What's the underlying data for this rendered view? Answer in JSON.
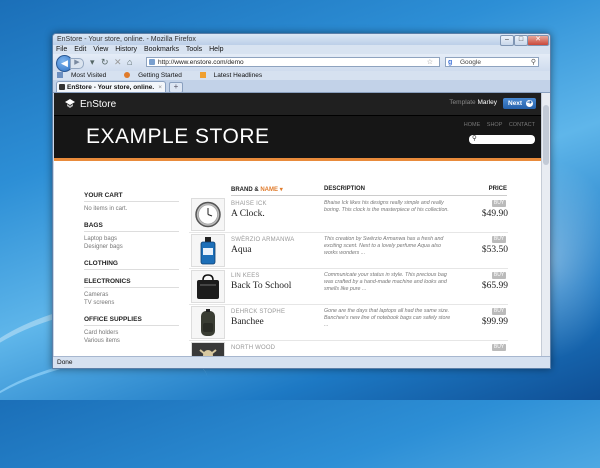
{
  "browser": {
    "title": "EnStore - Your store, online. - Mozilla Firefox",
    "menu": [
      "File",
      "Edit",
      "View",
      "History",
      "Bookmarks",
      "Tools",
      "Help"
    ],
    "url": "http://www.enstore.com/demo",
    "search_engine": "Google",
    "bookmarks": [
      "Most Visited",
      "Getting Started",
      "Latest Headlines"
    ],
    "tab_title": "EnStore - Your store, online.",
    "status": "Done"
  },
  "store": {
    "logo": "EnStore",
    "template_label": "Template",
    "template_name": "Marley",
    "next_label": "Next",
    "hero_title": "EXAMPLE STORE",
    "nav": [
      "HOME",
      "SHOP",
      "CONTACT"
    ]
  },
  "sidebar": {
    "cart_title": "YOUR CART",
    "cart_empty": "No items in cart.",
    "sections": [
      {
        "title": "BAGS",
        "items": [
          "Laptop bags",
          "Designer bags"
        ]
      },
      {
        "title": "CLOTHING",
        "items": []
      },
      {
        "title": "ELECTRONICS",
        "items": [
          "Cameras",
          "TV screens"
        ]
      },
      {
        "title": "OFFICE SUPPLIES",
        "items": [
          "Card holders",
          "Various items"
        ]
      }
    ]
  },
  "products_header": {
    "brand": "BRAND &",
    "name": "NAME",
    "description": "DESCRIPTION",
    "price": "PRICE"
  },
  "buy_label": "BUY",
  "products": [
    {
      "brand": "BHAISE ICK",
      "name": "A Clock.",
      "desc": "Bhaise Ick likes his designs really simple and really boring. This clock is the masterpiece of his collection.",
      "price": "$49.90",
      "icon": "clock-icon"
    },
    {
      "brand": "SWËRZIO ARMANWA",
      "name": "Aqua",
      "desc": "This creation by Swërzio Armanwa has a fresh and exciting scent. Next to a lovely perfume Aqua also works wonders ...",
      "price": "$53.50",
      "icon": "perfume-icon"
    },
    {
      "brand": "LIN KEES",
      "name": "Back To School",
      "desc": "Communicate your status in style. This precious bag was crafted by a hand-made machine and looks and smells like pure ...",
      "price": "$65.99",
      "icon": "bag-icon"
    },
    {
      "brand": "DEHRCK STOPHE",
      "name": "Banchee",
      "desc": "Gone are the days that laptops all had the same size. Banchee's new line of notebook bags can safely store ...",
      "price": "$99.99",
      "icon": "backpack-icon"
    },
    {
      "brand": "NORTH WOOD",
      "name": "",
      "desc": "",
      "price": "",
      "icon": "figure-icon"
    }
  ]
}
